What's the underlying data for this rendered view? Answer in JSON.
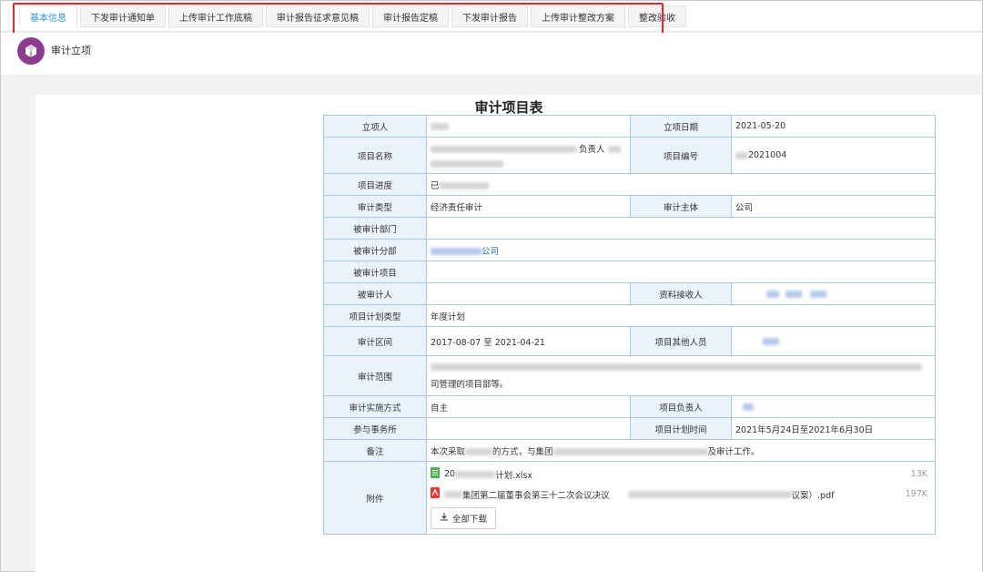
{
  "tabs": [
    {
      "label": "基本信息",
      "active": true
    },
    {
      "label": "下发审计通知单",
      "active": false
    },
    {
      "label": "上传审计工作底稿",
      "active": false
    },
    {
      "label": "审计报告征求意见稿",
      "active": false
    },
    {
      "label": "审计报告定稿",
      "active": false
    },
    {
      "label": "下发审计报告",
      "active": false
    },
    {
      "label": "上传审计整改方案",
      "active": false
    },
    {
      "label": "整改验收",
      "active": false
    }
  ],
  "header": {
    "title": "审计立项",
    "icon": "cube-icon"
  },
  "document": {
    "title": "审计项目表"
  },
  "labels": {
    "initiator": "立项人",
    "start_date": "立项日期",
    "project_name": "项目名称",
    "project_no": "项目编号",
    "progress": "项目进度",
    "audit_type": "审计类型",
    "audit_subject": "审计主体",
    "audited_dept": "被审计部门",
    "audited_branch": "被审计分部",
    "audited_project": "被审计项目",
    "audited_person": "被审计人",
    "receiver": "资料接收人",
    "plan_type": "项目计划类型",
    "audit_period": "审计区间",
    "other_members": "项目其他人员",
    "scope": "审计范围",
    "method": "审计实施方式",
    "leader": "项目负责人",
    "firm": "参与事务所",
    "plan_time": "项目计划时间",
    "remark": "备注",
    "attachments": "附件"
  },
  "values": {
    "start_date": "2021-05-20",
    "project_name_suffix": "负责人",
    "project_no": "2021004",
    "progress": "已",
    "audit_type": "经济责任审计",
    "audit_subject": "公司",
    "audited_branch": "公司",
    "plan_type": "年度计划",
    "audit_period": "2017-08-07 至  2021-04-21",
    "scope_line2": "司管理的项目部等。",
    "method": "自主",
    "plan_time": "2021年5月24日至2021年6月30日",
    "remark_a": "本次采取",
    "remark_b": "的方式，与集团",
    "remark_c": "及审计工作。"
  },
  "attachments": [
    {
      "icon": "excel-file-icon",
      "name_prefix": "20",
      "name_suffix": "计划.xlsx",
      "size": "13K"
    },
    {
      "icon": "pdf-file-icon",
      "name_prefix": "集团第二届董事会第三十二次会议决议",
      "name_suffix": "议案）.pdf",
      "size": "197K"
    }
  ],
  "download_all_label": "全部下载",
  "colors": {
    "accent": "#2f8fd8",
    "highlight": "#e0292e",
    "label_bg": "#eaf2fa",
    "border": "#a9c6e2",
    "header_icon": "#8a3d8e"
  }
}
